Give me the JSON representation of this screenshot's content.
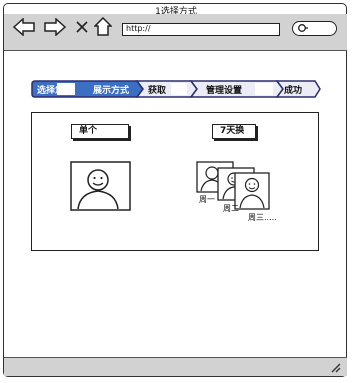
{
  "window": {
    "title": "1选择方式"
  },
  "browser": {
    "url_value": "http://"
  },
  "steps": [
    {
      "label": "选择您",
      "active": true
    },
    {
      "label": "展示方式",
      "active": true
    },
    {
      "label": "获取",
      "active": false
    },
    {
      "label": "管理设置",
      "active": false
    },
    {
      "label": "成功",
      "active": false
    }
  ],
  "options": {
    "single": {
      "label": "单个"
    },
    "seven_day": {
      "label": "7天换",
      "days": [
        "周一",
        "周二",
        "周三....."
      ]
    }
  },
  "colors": {
    "active_step": "#3a6fc4",
    "chrome": "#d2d2d2",
    "step_border": "#2c2c6e"
  },
  "icons": [
    "back-arrow-icon",
    "forward-arrow-icon",
    "close-icon",
    "home-icon",
    "search-icon",
    "resize-grip-icon",
    "avatar-icon"
  ]
}
